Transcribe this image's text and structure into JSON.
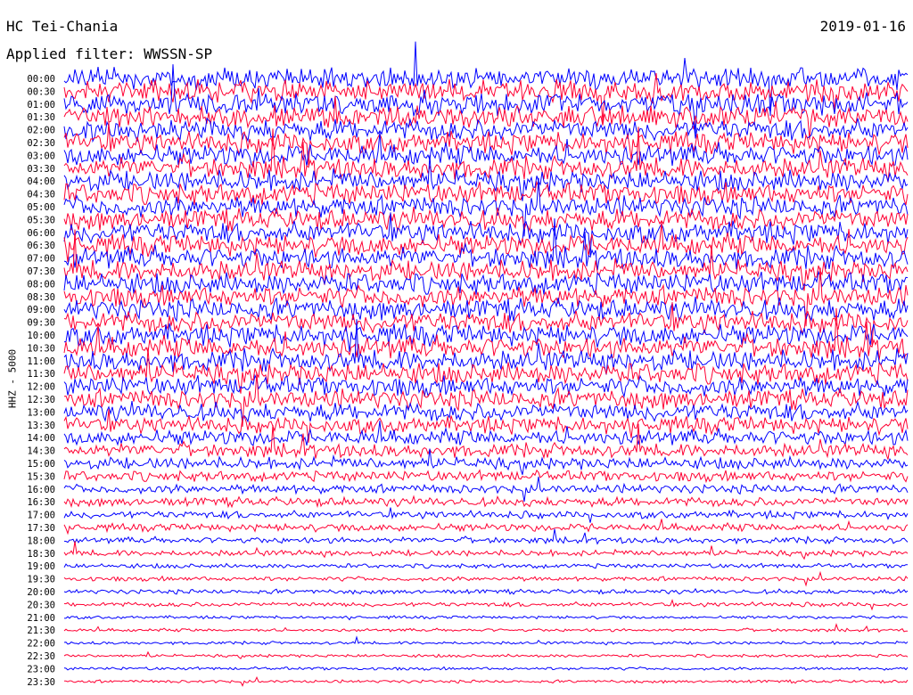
{
  "header": {
    "station": "HC Tei-Chania",
    "filter": "Applied filter: WWSSN-SP",
    "date": "2019-01-16",
    "channel": "HHZ - 5000"
  },
  "chart_data": {
    "type": "line",
    "rows": [
      "00:00",
      "00:30",
      "01:00",
      "01:30",
      "02:00",
      "02:30",
      "03:00",
      "03:30",
      "04:00",
      "04:30",
      "05:00",
      "05:30",
      "06:00",
      "06:30",
      "07:00",
      "07:30",
      "08:00",
      "08:30",
      "09:00",
      "09:30",
      "10:00",
      "10:30",
      "11:00",
      "11:30",
      "12:00",
      "12:30",
      "13:00",
      "13:30",
      "14:00",
      "14:30",
      "15:00",
      "15:30",
      "16:00",
      "16:30",
      "17:00",
      "17:30",
      "18:00",
      "18:30",
      "19:00",
      "19:30",
      "20:00",
      "20:30",
      "21:00",
      "21:30",
      "22:00",
      "22:30",
      "23:00",
      "23:30"
    ],
    "row_minutes": 30,
    "amplitude_relative": [
      14,
      14,
      14,
      14,
      14,
      14,
      14,
      14,
      14,
      14,
      14,
      14,
      14,
      14,
      14,
      14,
      14,
      14,
      14,
      14,
      14,
      14,
      14,
      14,
      13,
      13,
      12,
      11,
      10,
      9,
      8,
      7,
      6,
      6,
      5,
      5,
      4,
      4,
      3,
      3,
      3,
      3,
      2,
      2,
      2,
      2,
      2,
      2
    ],
    "series_colors": [
      "#0000ff",
      "#ff0033"
    ],
    "grid": false
  }
}
